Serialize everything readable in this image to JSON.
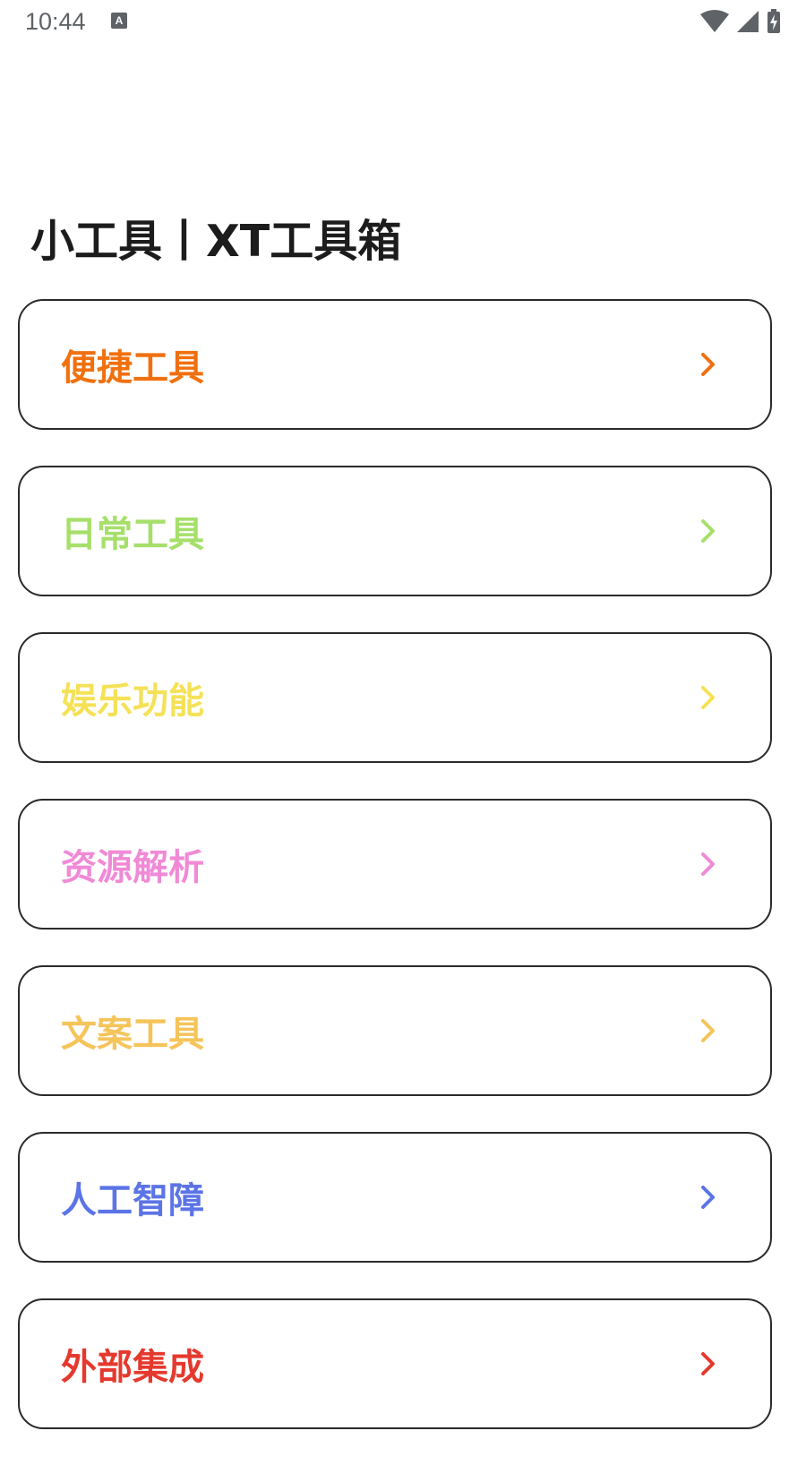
{
  "status_bar": {
    "time": "10:44",
    "notification_icon": "A",
    "icons": [
      "notification-icon",
      "wifi-icon",
      "signal-icon",
      "battery-charging-icon"
    ]
  },
  "page": {
    "title": "小工具丨XT工具箱"
  },
  "menu": [
    {
      "label": "便捷工具",
      "color": "#f0700f"
    },
    {
      "label": "日常工具",
      "color": "#a6df6a"
    },
    {
      "label": "娱乐功能",
      "color": "#f5e157"
    },
    {
      "label": "资源解析",
      "color": "#f08ad6"
    },
    {
      "label": "文案工具",
      "color": "#f5c45a"
    },
    {
      "label": "人工智障",
      "color": "#5b74e6"
    },
    {
      "label": "外部集成",
      "color": "#e5392e"
    }
  ],
  "icons": {
    "chevron": "chevron-right-icon"
  }
}
